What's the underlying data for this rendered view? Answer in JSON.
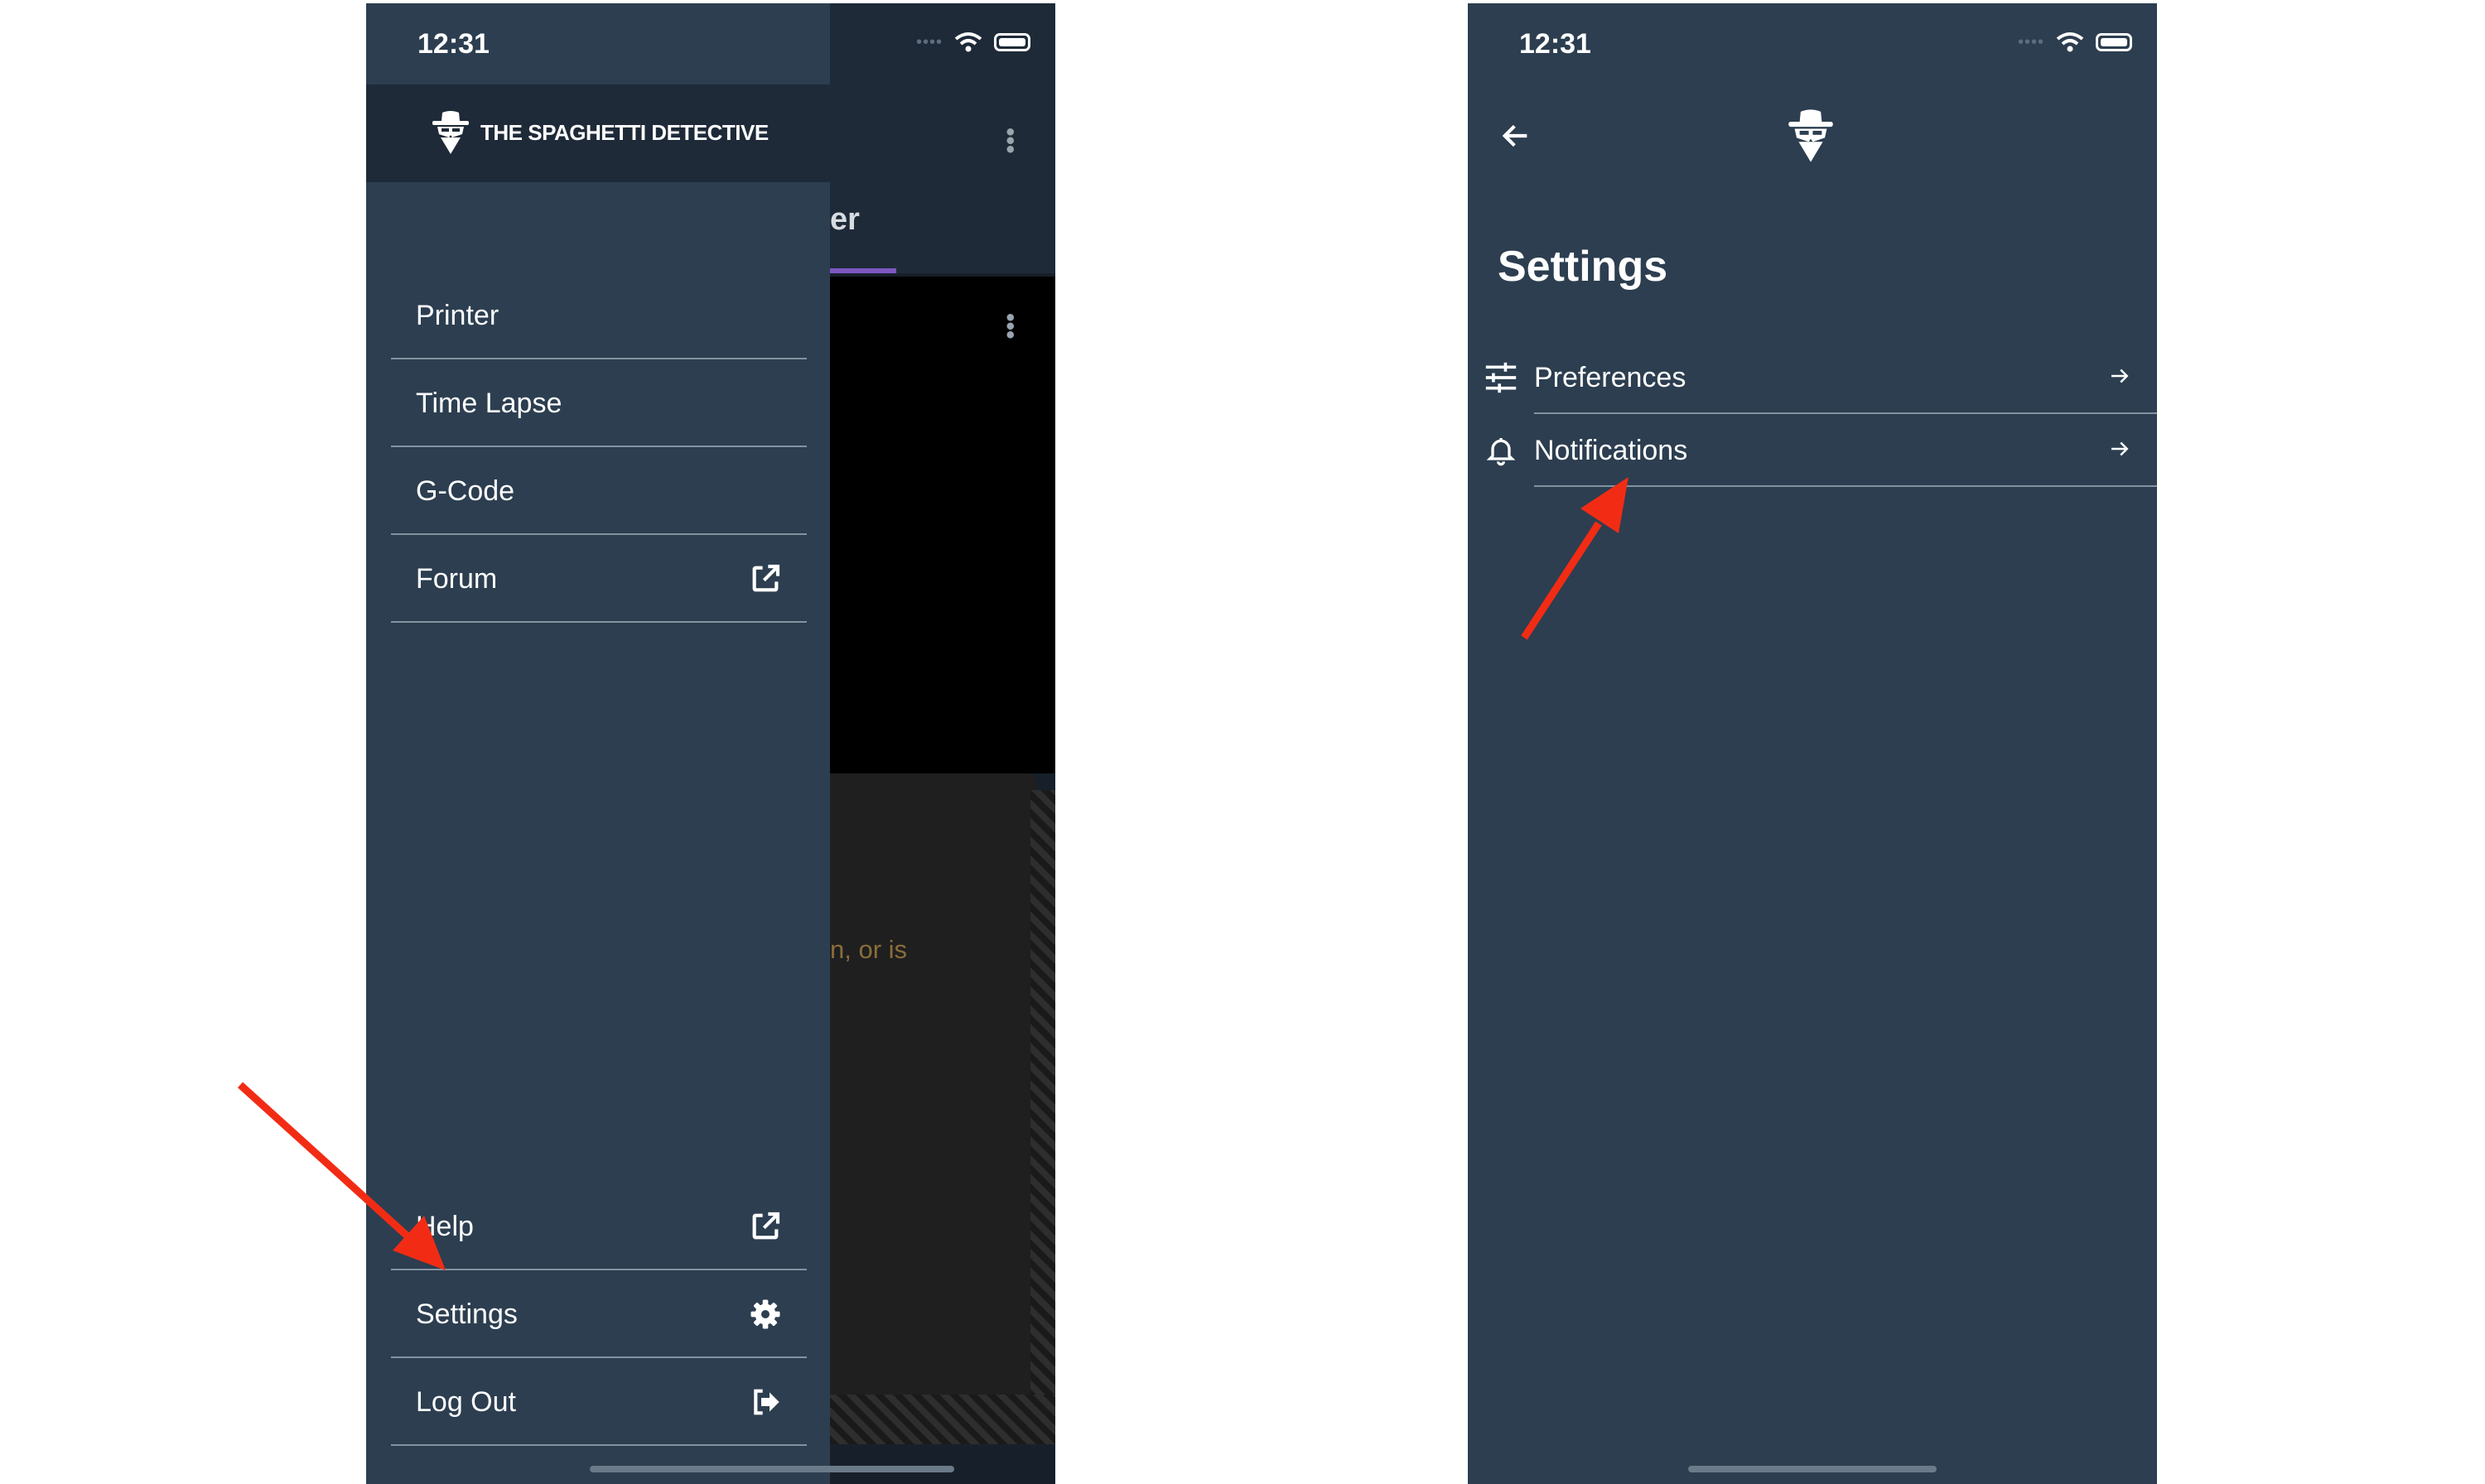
{
  "colors": {
    "app_bg": "#2c3e50",
    "header_bg": "#1e2a38",
    "divider": "#8492a0",
    "arrow_red": "#f22c14",
    "tab_accent": "#7e57c2"
  },
  "status_bar": {
    "time": "12:31"
  },
  "left_screen": {
    "brand": "THE SPAGHETTI DETECTIVE",
    "background_tab_fragment": "er",
    "background_warning_fragment": "n, or is",
    "drawer_items_top": [
      {
        "label": "Printer",
        "icon": null
      },
      {
        "label": "Time Lapse",
        "icon": null
      },
      {
        "label": "G-Code",
        "icon": null
      },
      {
        "label": "Forum",
        "icon": "external-link-icon"
      }
    ],
    "drawer_items_bottom": [
      {
        "label": "Help",
        "icon": "external-link-icon"
      },
      {
        "label": "Settings",
        "icon": "gear-icon"
      },
      {
        "label": "Log Out",
        "icon": "logout-icon"
      }
    ]
  },
  "right_screen": {
    "title": "Settings",
    "rows": [
      {
        "label": "Preferences",
        "icon": "sliders-icon"
      },
      {
        "label": "Notifications",
        "icon": "bell-icon"
      }
    ]
  },
  "annotations": [
    {
      "type": "arrow",
      "target": "Settings menu item",
      "color": "#f22c14"
    },
    {
      "type": "arrow",
      "target": "Notifications row",
      "color": "#f22c14"
    }
  ]
}
